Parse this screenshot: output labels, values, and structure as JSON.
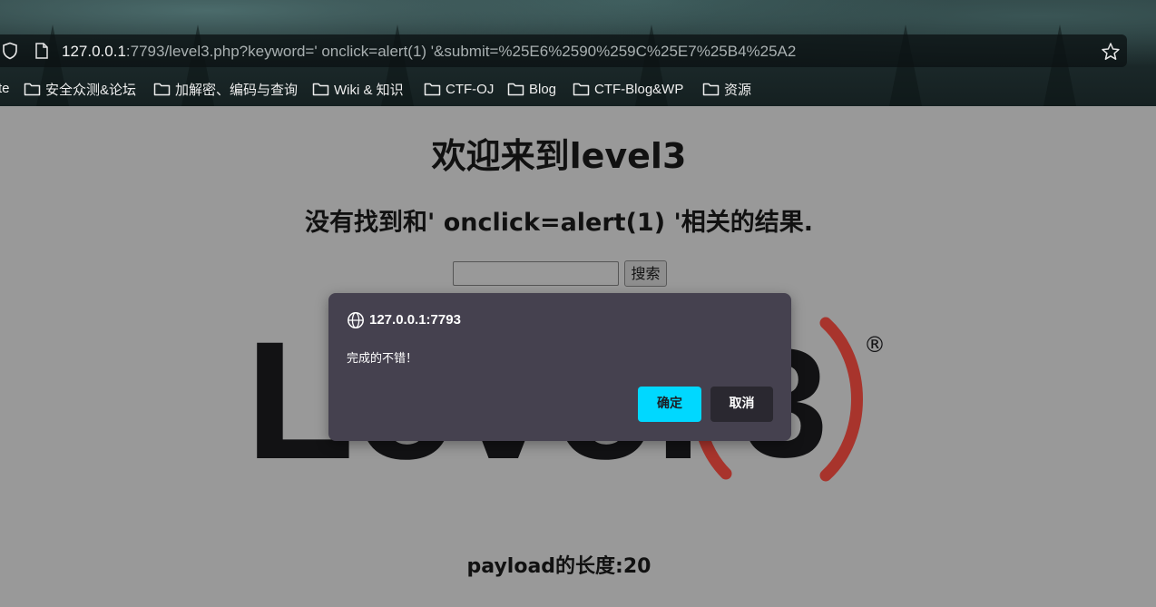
{
  "browser": {
    "url_host": "127.0.0.1",
    "url_path": ":7793/level3.php?keyword=' onclick=alert(1) '&submit=%25E6%2590%259C%25E7%25B4%25A2",
    "bookmarks_cut_label": "te",
    "bookmarks": [
      {
        "label": "安全众测&论坛"
      },
      {
        "label": "加解密、编码与查询"
      },
      {
        "label": "Wiki & 知识"
      },
      {
        "label": "CTF-OJ"
      },
      {
        "label": "Blog"
      },
      {
        "label": "CTF-Blog&WP"
      },
      {
        "label": "资源"
      }
    ],
    "icons": {
      "shield": "shield-icon",
      "page": "page-icon",
      "star": "star-icon",
      "folder": "folder-icon"
    }
  },
  "page": {
    "title": "欢迎来到level3",
    "result": "没有找到和' onclick=alert(1) '相关的结果.",
    "search_value": "",
    "search_button": "搜索",
    "logo_text": "Level",
    "logo_number": "3",
    "logo_mark": "®",
    "payload_length": "payload的长度:20"
  },
  "dialog": {
    "origin": "127.0.0.1:7793",
    "message": "完成的不错！",
    "ok_label": "确定",
    "cancel_label": "取消",
    "icon": "globe-icon"
  },
  "colors": {
    "page_background": "#999999",
    "dialog_background": "#45414f",
    "ok_button": "#00d8ff",
    "cancel_button": "#2a2830",
    "logo_dark": "#121214",
    "logo_red": "#a8342c"
  }
}
